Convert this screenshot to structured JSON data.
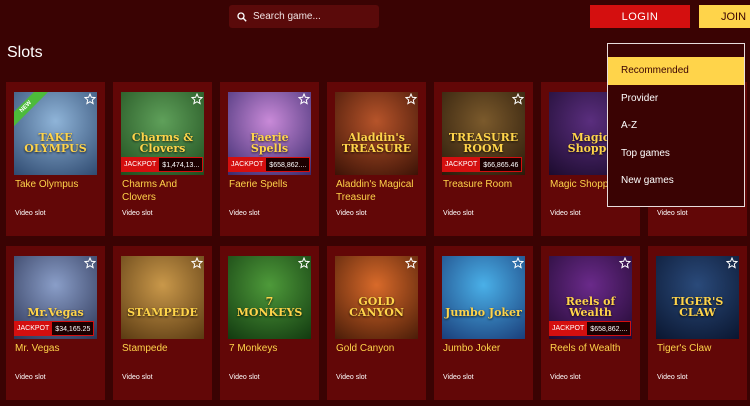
{
  "header": {
    "search_placeholder": "Search game...",
    "login_label": "LOGIN",
    "join_label": "JOIN"
  },
  "page_title": "Slots",
  "sort_menu": {
    "items": [
      "Recommended",
      "Provider",
      "A-Z",
      "Top games",
      "New games"
    ],
    "selected": "Recommended"
  },
  "games": [
    {
      "name": "Take Olympus",
      "type": "Video slot",
      "art": "TAKE OLYMPUS",
      "badge": "NEW",
      "jackpot": null,
      "bg": [
        "#8fb4d8",
        "#2f4a70"
      ]
    },
    {
      "name": "Charms And Clovers",
      "type": "Video slot",
      "art": "Charms & Clovers",
      "jackpot": "$1,474,13...",
      "bg": [
        "#5fa05a",
        "#1f4d1e"
      ]
    },
    {
      "name": "Faerie Spells",
      "type": "Video slot",
      "art": "Faerie Spells",
      "jackpot": "$658,862....",
      "bg": [
        "#c98ad8",
        "#3a2a6e"
      ]
    },
    {
      "name": "Aladdin's Magical Treasure",
      "type": "Video slot",
      "art": "Aladdin's TREASURE",
      "jackpot": null,
      "bg": [
        "#b6542a",
        "#3c1206"
      ]
    },
    {
      "name": "Treasure Room",
      "type": "Video slot",
      "art": "TREASURE ROOM",
      "jackpot": "$66,865.46",
      "bg": [
        "#7b5a2c",
        "#2a1a0a"
      ]
    },
    {
      "name": "Magic Shoppe",
      "type": "Video slot",
      "art": "Magic Shoppe",
      "jackpot": null,
      "bg": [
        "#5a2e7e",
        "#1c0b2e"
      ]
    },
    {
      "name": "",
      "type": "Video slot",
      "art": "",
      "jackpot": null,
      "bg": [
        "#3a1e4e",
        "#1a0a22"
      ]
    },
    {
      "name": "Mr. Vegas",
      "type": "Video slot",
      "art": "Mr.Vegas",
      "jackpot": "$34,165.25",
      "bg": [
        "#8a9ec8",
        "#2c3556"
      ]
    },
    {
      "name": "Stampede",
      "type": "Video slot",
      "art": "STAMPEDE",
      "jackpot": null,
      "bg": [
        "#c9984a",
        "#5a3a12"
      ]
    },
    {
      "name": "7 Monkeys",
      "type": "Video slot",
      "art": "7 MONKEYS",
      "jackpot": null,
      "bg": [
        "#4e9a3a",
        "#123a10"
      ]
    },
    {
      "name": "Gold Canyon",
      "type": "Video slot",
      "art": "GOLD CANYON",
      "jackpot": null,
      "bg": [
        "#d86a2a",
        "#4a1c08"
      ]
    },
    {
      "name": "Jumbo Joker",
      "type": "Video slot",
      "art": "Jumbo Joker",
      "jackpot": null,
      "bg": [
        "#4ab0e8",
        "#1a3e7a"
      ]
    },
    {
      "name": "Reels of Wealth",
      "type": "Video slot",
      "art": "Reels of Wealth",
      "jackpot": "$658,862....",
      "bg": [
        "#6a2a8a",
        "#220a32"
      ]
    },
    {
      "name": "Tiger's Claw",
      "type": "Video slot",
      "art": "TIGER'S CLAW",
      "jackpot": null,
      "bg": [
        "#2a4a7a",
        "#0a1630"
      ]
    }
  ],
  "jackpot_label": "JACKPOT",
  "colors": {
    "background": "#3a0303",
    "card": "#620707",
    "accent_yellow": "#ffd44a",
    "accent_red": "#d40f0f"
  }
}
